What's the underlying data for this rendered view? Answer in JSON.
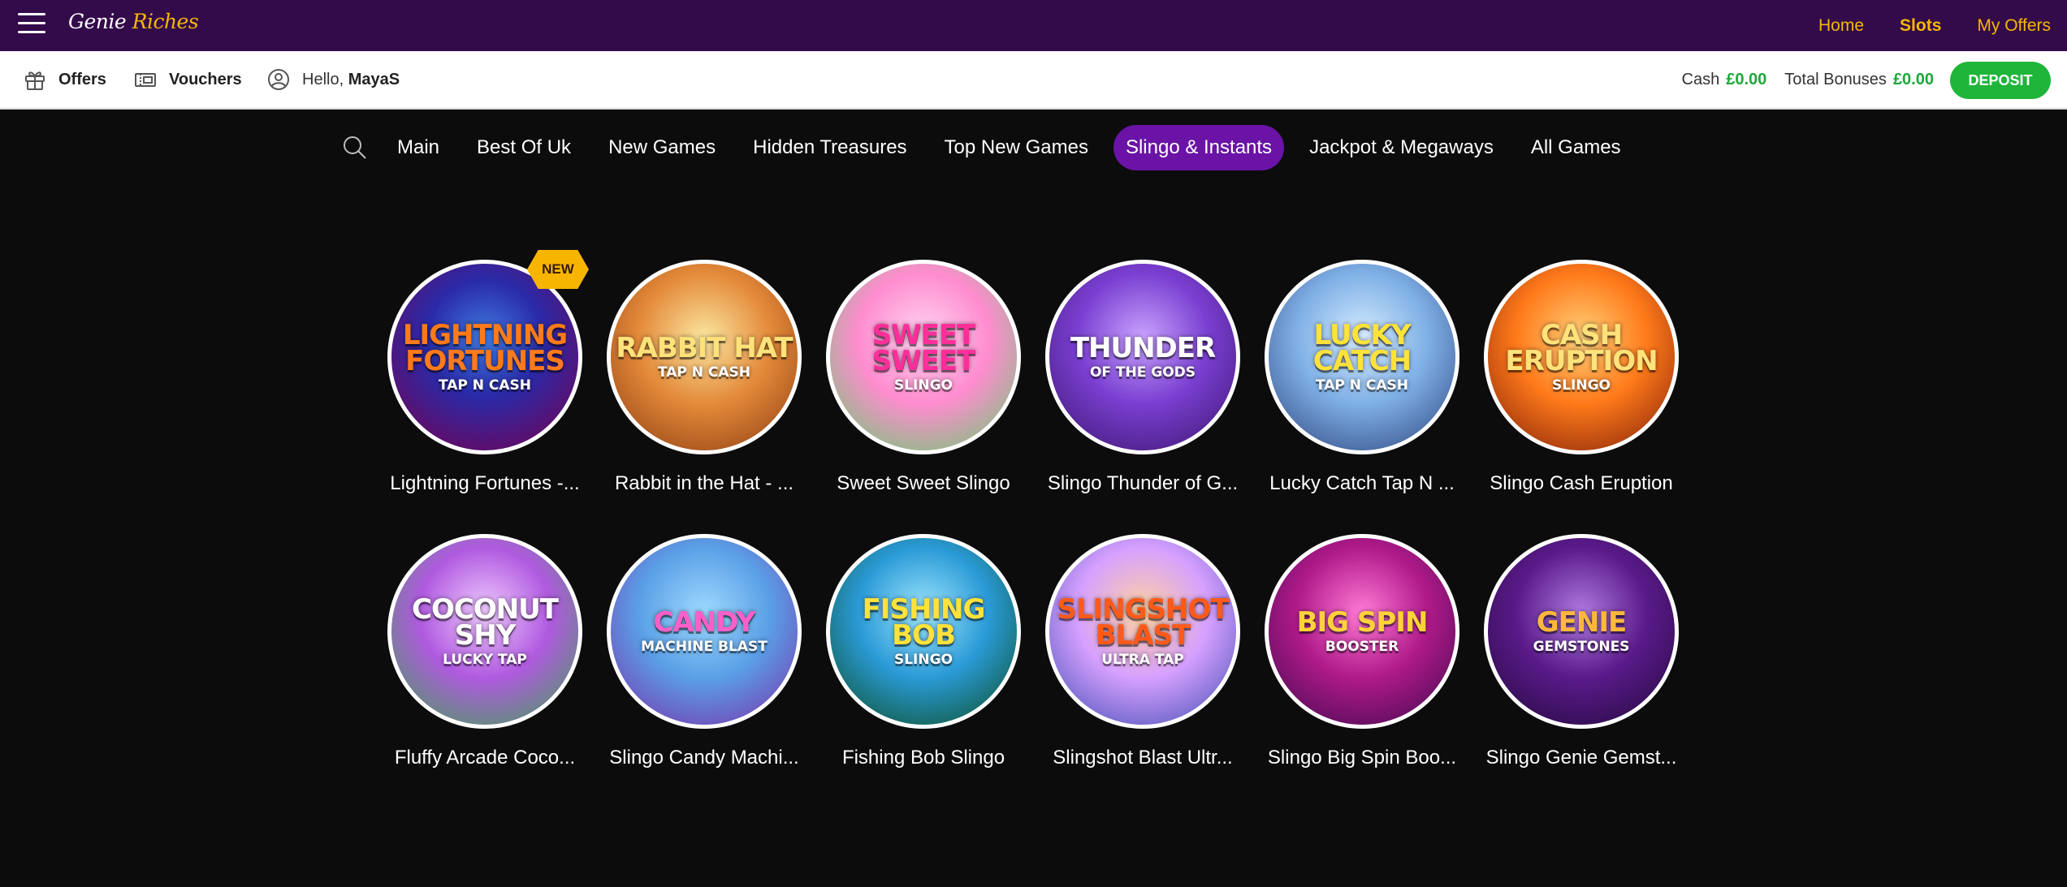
{
  "brand": {
    "name_part1": "Genie",
    "name_part2": "Riches"
  },
  "topnav": {
    "home": "Home",
    "slots": "Slots",
    "my_offers": "My Offers"
  },
  "account": {
    "offers": "Offers",
    "vouchers": "Vouchers",
    "hello_prefix": "Hello,",
    "username": "MayaS",
    "cash_label": "Cash",
    "cash_amount": "£0.00",
    "bonus_label": "Total Bonuses",
    "bonus_amount": "£0.00",
    "deposit_label": "DEPOSIT"
  },
  "categories": [
    {
      "label": "Main",
      "active": false
    },
    {
      "label": "Best Of Uk",
      "active": false
    },
    {
      "label": "New Games",
      "active": false
    },
    {
      "label": "Hidden Treasures",
      "active": false
    },
    {
      "label": "Top New Games",
      "active": false
    },
    {
      "label": "Slingo & Instants",
      "active": true
    },
    {
      "label": "Jackpot & Megaways",
      "active": false
    },
    {
      "label": "All Games",
      "active": false
    }
  ],
  "colors": {
    "topbar": "#330a4a",
    "accent_gold": "#f5b800",
    "active_category": "#6a13a6",
    "deposit_green": "#1eb53a",
    "balance_green": "#1ea83a"
  },
  "games": [
    {
      "name": "Lightning Fortunes -...",
      "art_title": "Lightning Fortunes",
      "art_sub": "TAP N CASH",
      "badge": "NEW",
      "bg": "radial-gradient(circle at 50% 40%, #3f7ae0 0%, #2a2aa8 40%, #5a1070 75%, #2a0838 100%)",
      "fg": "#ff7a1a"
    },
    {
      "name": "Rabbit in the Hat - ...",
      "art_title": "Rabbit Hat",
      "art_sub": "TAP N CASH",
      "badge": "",
      "bg": "radial-gradient(circle at 50% 40%, #fbe6a0 0%, #e48a3a 45%, #8a3a10 100%)",
      "fg": "#ffe27a"
    },
    {
      "name": "Sweet Sweet Slingo",
      "art_title": "Sweet Sweet",
      "art_sub": "SLINGO",
      "badge": "",
      "bg": "radial-gradient(circle at 50% 40%, #ffd6f2 0%, #ff8ccf 45%, #5fd06a 100%)",
      "fg": "#ff2e9a"
    },
    {
      "name": "Slingo Thunder of G...",
      "art_title": "Thunder",
      "art_sub": "OF THE GODS",
      "badge": "",
      "bg": "radial-gradient(circle at 50% 40%, #c9a3ff 0%, #7a3fd1 45%, #3a136a 100%)",
      "fg": "#ffffff"
    },
    {
      "name": "Lucky Catch Tap N ...",
      "art_title": "Lucky Catch",
      "art_sub": "TAP N CASH",
      "badge": "",
      "bg": "radial-gradient(circle at 50% 40%, #d6ecff 0%, #7fb0e6 45%, #2a3f7a 100%)",
      "fg": "#ffe23a"
    },
    {
      "name": "Slingo Cash Eruption",
      "art_title": "Cash Eruption",
      "art_sub": "SLINGO",
      "badge": "",
      "bg": "radial-gradient(circle at 50% 40%, #ffd27a 0%, #ff7a1a 45%, #7a1a08 100%)",
      "fg": "#ffe27a"
    },
    {
      "name": "Fluffy Arcade Coco...",
      "art_title": "Coconut Shy",
      "art_sub": "LUCKY TAP",
      "badge": "",
      "bg": "radial-gradient(circle at 50% 40%, #f0ccff 0%, #b05ae0 45%, #3aa64a 100%)",
      "fg": "#ffffff"
    },
    {
      "name": "Slingo Candy Machi...",
      "art_title": "Candy",
      "art_sub": "MACHINE BLAST",
      "badge": "",
      "bg": "radial-gradient(circle at 50% 40%, #9fd9ff 0%, #5aa0e6 45%, #7a2aa8 100%)",
      "fg": "#ff5fc8"
    },
    {
      "name": "Fishing Bob Slingo",
      "art_title": "Fishing Bob",
      "art_sub": "SLINGO",
      "badge": "",
      "bg": "radial-gradient(circle at 50% 40%, #9fe6ff 0%, #2a9ad6 45%, #0a4a1a 100%)",
      "fg": "#ffe23a"
    },
    {
      "name": "Slingshot Blast Ultr...",
      "art_title": "Slingshot Blast",
      "art_sub": "ultra tap",
      "badge": "",
      "bg": "radial-gradient(circle at 50% 40%, #ffd2a0 0%, #d6a0ff 45%, #3a4ab0 100%)",
      "fg": "#ff5a1a"
    },
    {
      "name": "Slingo Big Spin Boo...",
      "art_title": "Big Spin",
      "art_sub": "BOOSTER",
      "badge": "",
      "bg": "radial-gradient(circle at 50% 40%, #ff7ad6 0%, #b01a8a 45%, #3a084a 100%)",
      "fg": "#ffd23a"
    },
    {
      "name": "Slingo Genie Gemst...",
      "art_title": "Genie",
      "art_sub": "Gemstones",
      "badge": "",
      "bg": "radial-gradient(circle at 50% 40%, #b07ae0 0%, #5a1a8a 45%, #200838 100%)",
      "fg": "#ffb83a"
    }
  ]
}
